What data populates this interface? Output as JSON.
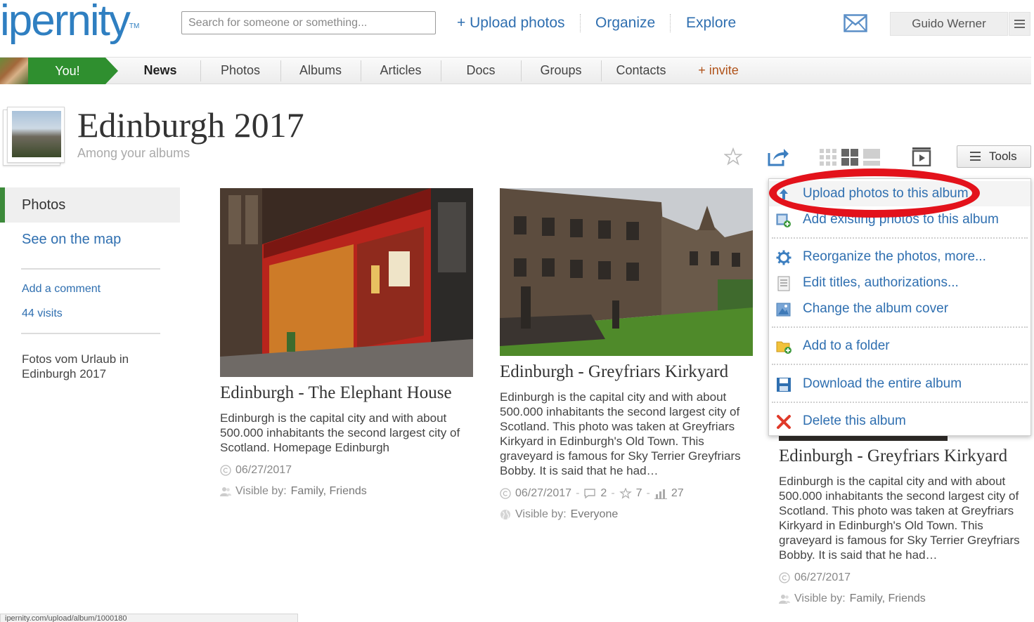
{
  "header": {
    "logo_text": "ipernity",
    "logo_tm": "TM",
    "search_placeholder": "Search for someone or something...",
    "upload_label": "+ Upload photos",
    "organize_label": "Organize",
    "explore_label": "Explore",
    "user_name": "Guido Werner"
  },
  "subnav": {
    "you_label": "You!",
    "tabs": [
      {
        "label": "News"
      },
      {
        "label": "Photos"
      },
      {
        "label": "Albums"
      },
      {
        "label": "Articles"
      },
      {
        "label": "Docs"
      },
      {
        "label": "Groups"
      },
      {
        "label": "Contacts"
      },
      {
        "label": "+ invite"
      }
    ]
  },
  "album": {
    "title": "Edinburgh 2017",
    "subtitle": "Among your albums",
    "tools_label": "Tools"
  },
  "sidebar": {
    "photos_label": "Photos",
    "map_label": "See on the map",
    "comment_label": "Add a comment",
    "visits_label": "44 visits",
    "description": "Fotos vom Urlaub in Edinburgh 2017"
  },
  "photos": [
    {
      "title": "Edinburgh - The Elephant House",
      "description": "Edinburgh is the capital city and with about 500.000 inhabitants the second largest city of Scotland. Homepage Edinburgh",
      "date": "06/27/2017",
      "visible_label": "Visible by:",
      "visible_value": "Family, Friends"
    },
    {
      "title": "Edinburgh - Greyfriars Kirkyard",
      "description": "Edinburgh is the capital city and with about 500.000 inhabitants the second largest city of Scotland. This photo was taken at Greyfriars Kirkyard in Edinburgh's Old Town. This graveyard is famous for Sky Terrier Greyfriars Bobby. It is said that he had…",
      "date": "06/27/2017",
      "comments": "2",
      "favs": "7",
      "views": "27",
      "visible_label": "Visible by:",
      "visible_value": "Everyone"
    },
    {
      "title": "Edinburgh - Greyfriars Kirkyard",
      "description": "Edinburgh is the capital city and with about 500.000 inhabitants the second largest city of Scotland. This photo was taken at Greyfriars Kirkyard in Edinburgh's Old Town. This graveyard is famous for Sky Terrier Greyfriars Bobby. It is said that he had…",
      "date": "06/27/2017",
      "visible_label": "Visible by:",
      "visible_value": "Family, Friends"
    }
  ],
  "tools_menu": [
    {
      "label": "Upload photos to this album",
      "icon": "upload-icon"
    },
    {
      "label": "Add existing photos to this album",
      "icon": "add-photos-icon"
    },
    {
      "label": "Reorganize the photos, more...",
      "icon": "gear-icon"
    },
    {
      "label": "Edit titles, authorizations...",
      "icon": "edit-list-icon"
    },
    {
      "label": "Change the album cover",
      "icon": "picture-icon"
    },
    {
      "label": "Add to a folder",
      "icon": "folder-add-icon"
    },
    {
      "label": "Download the entire album",
      "icon": "save-disk-icon"
    },
    {
      "label": "Delete this album",
      "icon": "delete-x-icon"
    }
  ],
  "statusbar": {
    "text": "ipernity.com/upload/album/1000180"
  },
  "colors": {
    "link_blue": "#2f6fb0",
    "you_green": "#2f8f2f",
    "annotation_red": "#e3121b"
  }
}
